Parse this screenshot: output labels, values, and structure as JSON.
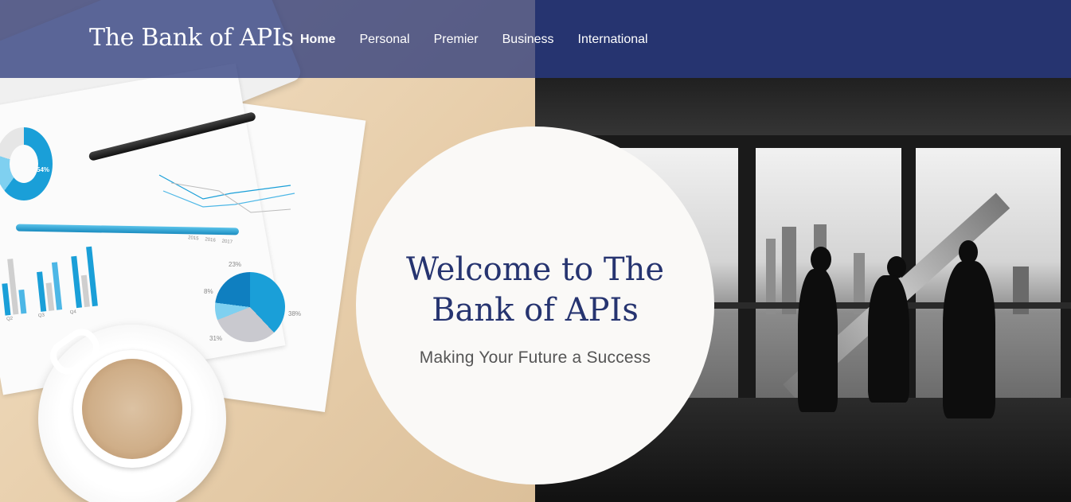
{
  "header": {
    "brand": "The Bank of APIs",
    "nav": [
      {
        "label": "Home",
        "active": true
      },
      {
        "label": "Personal",
        "active": false
      },
      {
        "label": "Premier",
        "active": false
      },
      {
        "label": "Business",
        "active": false
      },
      {
        "label": "International",
        "active": false
      }
    ]
  },
  "hero": {
    "title": "Welcome to The Bank of APIs",
    "subtitle": "Making Your Future a Success",
    "chart_labels": {
      "donut_left_pct": "54%",
      "pie_pct_top": "23%",
      "pie_pct_left": "8%",
      "pie_pct_right": "38%",
      "pie_pct_bottom": "31%",
      "bar_labels": [
        "Q2",
        "Q3",
        "Q4"
      ],
      "line_legend": [
        "2015",
        "2016",
        "2017"
      ]
    }
  },
  "colors": {
    "brand_navy": "#263470",
    "hero_circle": "#faf9f7",
    "chart_blue": "#1a9fd8"
  }
}
